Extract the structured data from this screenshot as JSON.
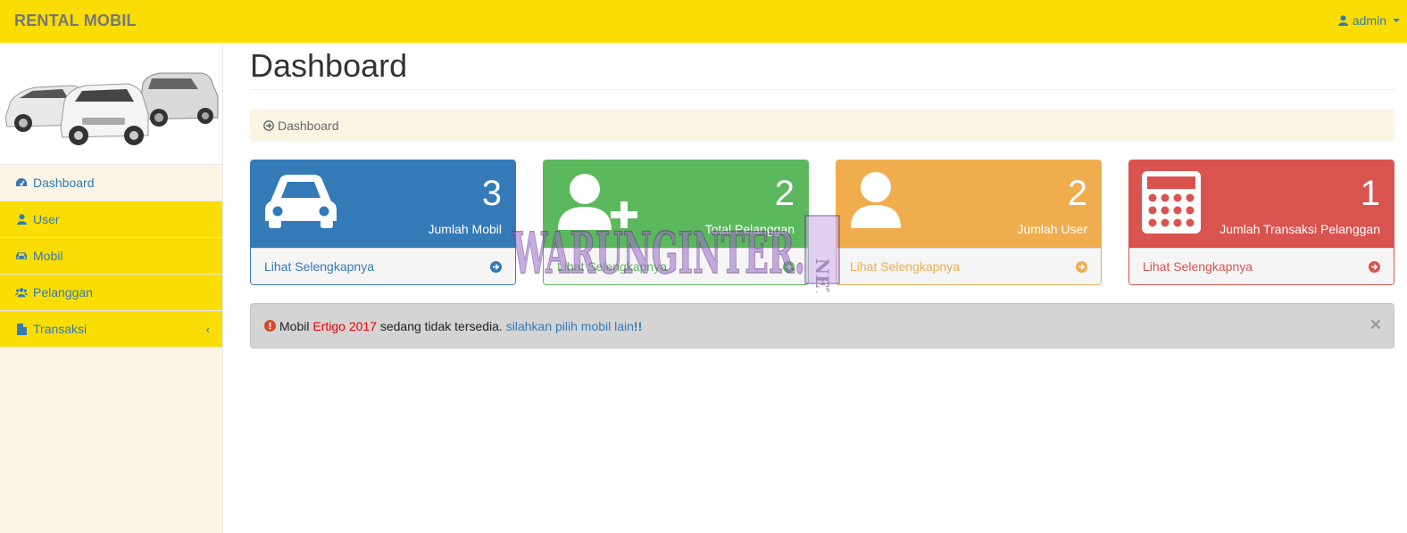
{
  "header": {
    "brand": "RENTAL MOBIL",
    "user_label": "admin"
  },
  "sidebar": {
    "items": [
      {
        "label": "Dashboard",
        "icon": "dashboard-icon"
      },
      {
        "label": "User",
        "icon": "user-icon"
      },
      {
        "label": "Mobil",
        "icon": "car-icon"
      },
      {
        "label": "Pelanggan",
        "icon": "users-icon"
      },
      {
        "label": "Transaksi",
        "icon": "file-icon"
      }
    ],
    "transaksi_chevron": "‹"
  },
  "main": {
    "title": "Dashboard",
    "breadcrumb": "Dashboard",
    "panels": [
      {
        "count": "3",
        "label": "Jumlah Mobil",
        "link": "Lihat Selengkapnya",
        "icon": "car-icon",
        "color": "#337ab7"
      },
      {
        "count": "2",
        "label": "Total Pelanggan",
        "link": "Lihat Selengkapnya",
        "icon": "user-plus-icon",
        "color": "#5cb85c"
      },
      {
        "count": "2",
        "label": "Jumlah User",
        "link": "Lihat Selengkapnya",
        "icon": "user-icon",
        "color": "#f0ad4e"
      },
      {
        "count": "1",
        "label": "Jumlah Transaksi Pelanggan",
        "link": "Lihat Selengkapnya",
        "icon": "calculator-icon",
        "color": "#d9534f"
      }
    ],
    "alert": {
      "prefix": "Mobil",
      "car_name": "Ertigo 2017",
      "middle": "sedang tidak tersedia.",
      "link_text": "silahkan pilih mobil lain",
      "suffix": "!!",
      "close": "×"
    }
  },
  "watermark": {
    "text": "WARUNGINTER.",
    "net": "NET"
  },
  "colors": {
    "topbar": "#f9dd04",
    "sidebar_bg": "#fdf5e4",
    "link": "#337ab7"
  }
}
